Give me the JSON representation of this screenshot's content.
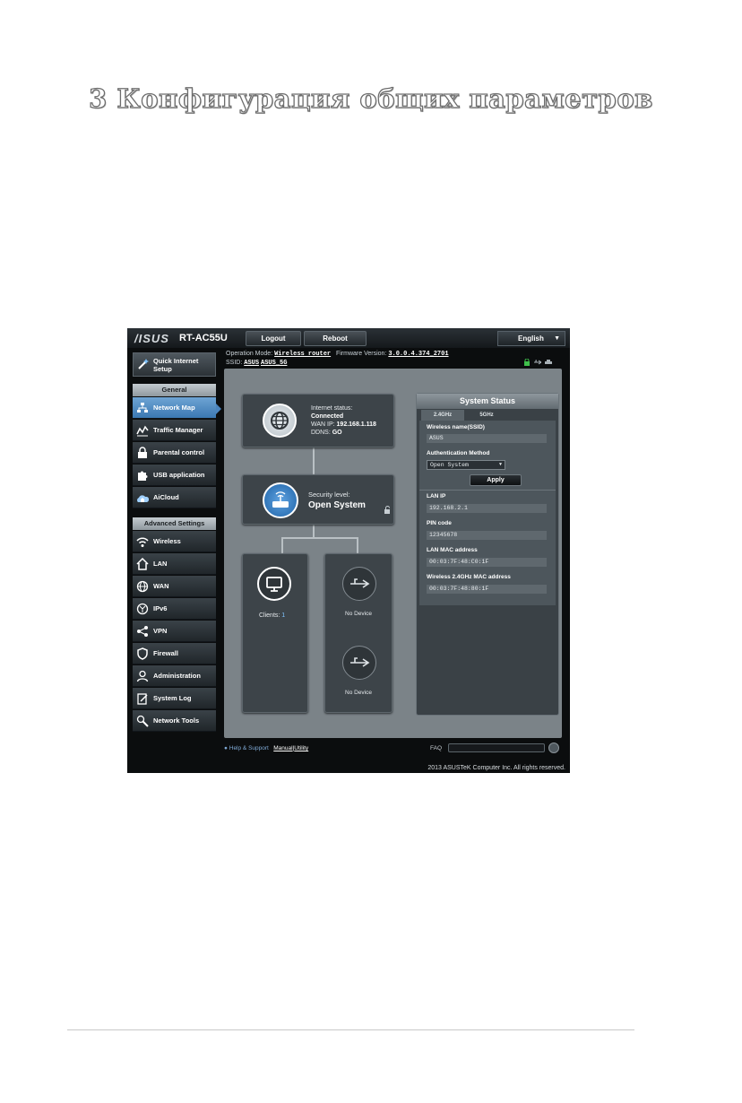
{
  "document": {
    "title": "3 Конфигурация общих параметров"
  },
  "router": {
    "brand": "/ISUS",
    "model": "RT-AC55U",
    "top_buttons": {
      "logout": "Logout",
      "reboot": "Reboot"
    },
    "language": "English",
    "info": {
      "operation_mode_label": "Operation Mode:",
      "operation_mode_value": "Wireless router",
      "firmware_label": "Firmware Version:",
      "firmware_value": "3.0.0.4.374_2701",
      "ssid_label": "SSID:",
      "ssid_values": [
        "ASUS",
        "ASUS_5G"
      ]
    },
    "sidebar": {
      "quick_setup": [
        "Quick Internet",
        "Setup"
      ],
      "general_header": "General",
      "general_items": [
        "Network Map",
        "Traffic Manager",
        "Parental control",
        "USB application",
        "AiCloud"
      ],
      "advanced_header": "Advanced Settings",
      "advanced_items": [
        "Wireless",
        "LAN",
        "WAN",
        "IPv6",
        "VPN",
        "Firewall",
        "Administration",
        "System Log",
        "Network Tools"
      ]
    },
    "network_map": {
      "internet_status_label": "Internet status:",
      "internet_status_value": "Connected",
      "wan_ip_label": "WAN IP:",
      "wan_ip_value": "192.168.1.118",
      "ddns_label": "DDNS:",
      "ddns_value": "GO",
      "security_label": "Security level:",
      "security_value": "Open System",
      "clients_label": "Clients:",
      "clients_value": "1",
      "usb_1": "No Device",
      "usb_2": "No Device"
    },
    "system_status": {
      "title": "System Status",
      "tabs": [
        "2.4GHz",
        "5GHz"
      ],
      "wireless_name_label": "Wireless name(SSID)",
      "wireless_name_value": "ASUS",
      "auth_label": "Authentication Method",
      "auth_value": "Open System",
      "apply": "Apply",
      "lan_ip_label": "LAN IP",
      "lan_ip_value": "192.168.2.1",
      "pin_label": "PIN code",
      "pin_value": "12345678",
      "lan_mac_label": "LAN MAC address",
      "lan_mac_value": "00:03:7F:48:C0:1F",
      "wl_mac_label": "Wireless 2.4GHz MAC address",
      "wl_mac_value": "00:03:7F:48:80:1F"
    },
    "footer": {
      "help": "Help & Support",
      "manual": "Manual",
      "separator": "|",
      "utility": "Utility",
      "faq": "FAQ",
      "copyright": "2013 ASUSTeK Computer Inc. All rights reserved."
    }
  }
}
